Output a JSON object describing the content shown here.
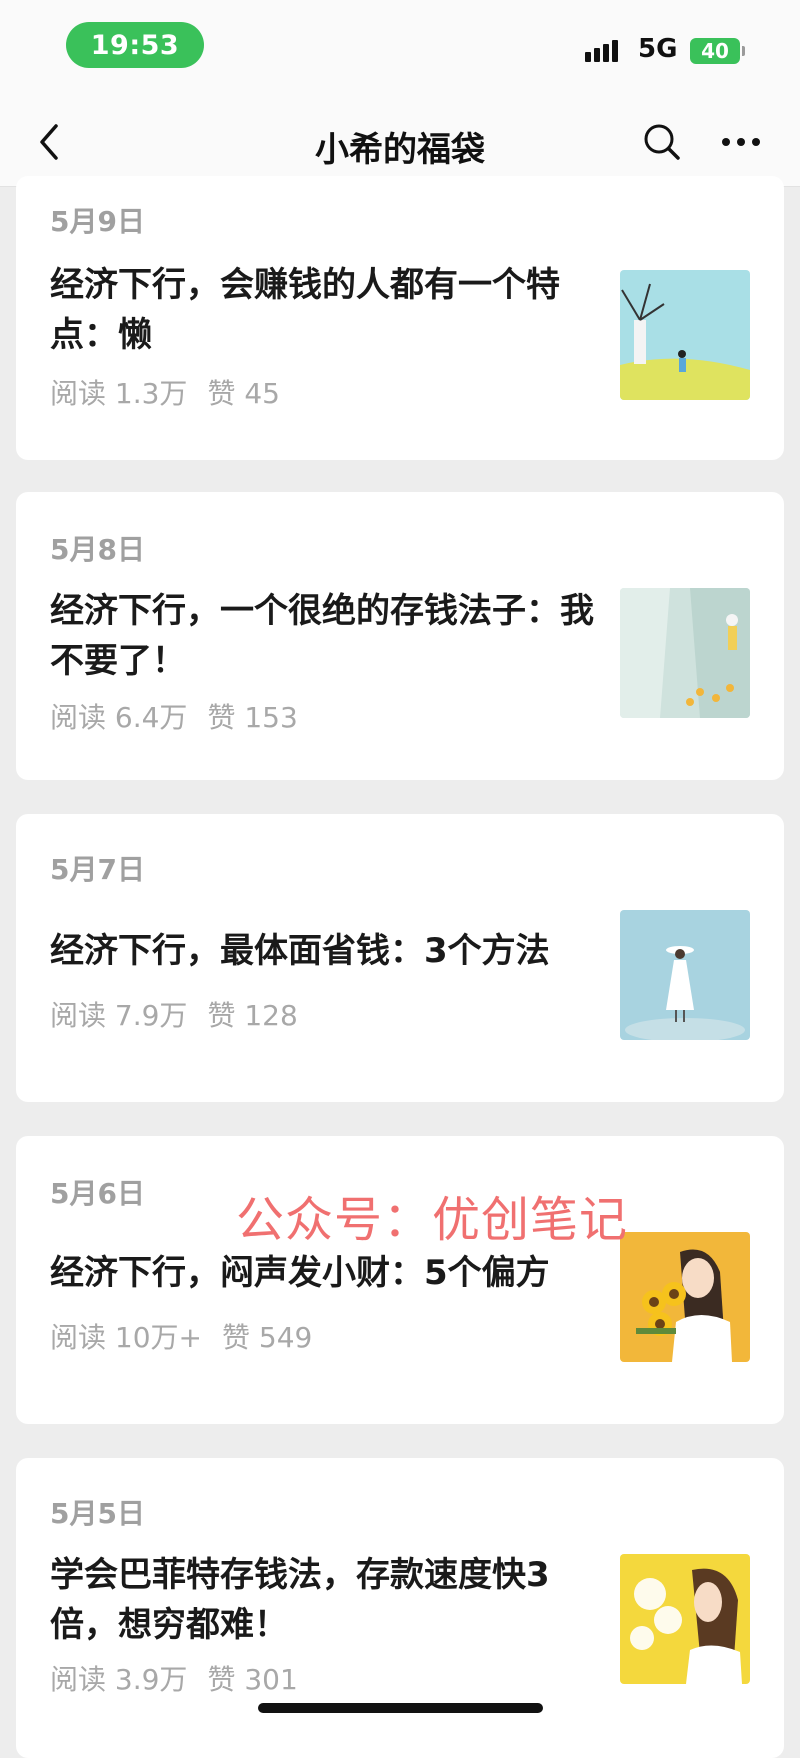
{
  "status_bar": {
    "time": "19:53",
    "network": "5G",
    "battery": "40"
  },
  "nav": {
    "title": "小希的福袋",
    "back_icon": "chevron-left-icon",
    "search_icon": "search-icon",
    "more_icon": "more-icon"
  },
  "articles": [
    {
      "date": "5月9日",
      "title": "经济下行，会赚钱的人都有一个特点：懒",
      "reads": "阅读 1.3万",
      "likes": "赞 45",
      "thumb": "windmill-girl-image"
    },
    {
      "date": "5月8日",
      "title": "经济下行，一个很绝的存钱法子：我不要了！",
      "reads": "阅读 6.4万",
      "likes": "赞 153",
      "thumb": "flower-corridor-image"
    },
    {
      "date": "5月7日",
      "title": "经济下行，最体面省钱：3个方法",
      "reads": "阅读 7.9万",
      "likes": "赞 128",
      "thumb": "girl-white-dress-image"
    },
    {
      "date": "5月6日",
      "title": "经济下行，闷声发小财：5个偏方",
      "reads": "阅读 10万+",
      "likes": "赞 549",
      "thumb": "sunflower-girl-image"
    },
    {
      "date": "5月5日",
      "title": "学会巴菲特存钱法，存款速度快3倍，想穷都难！",
      "reads": "阅读 3.9万",
      "likes": "赞 301",
      "thumb": "dandelion-girl-image"
    }
  ],
  "watermark": "公众号：优创笔记",
  "colors": {
    "accent_green": "#3ac15a",
    "watermark": "#f07070",
    "background": "#ededed"
  }
}
